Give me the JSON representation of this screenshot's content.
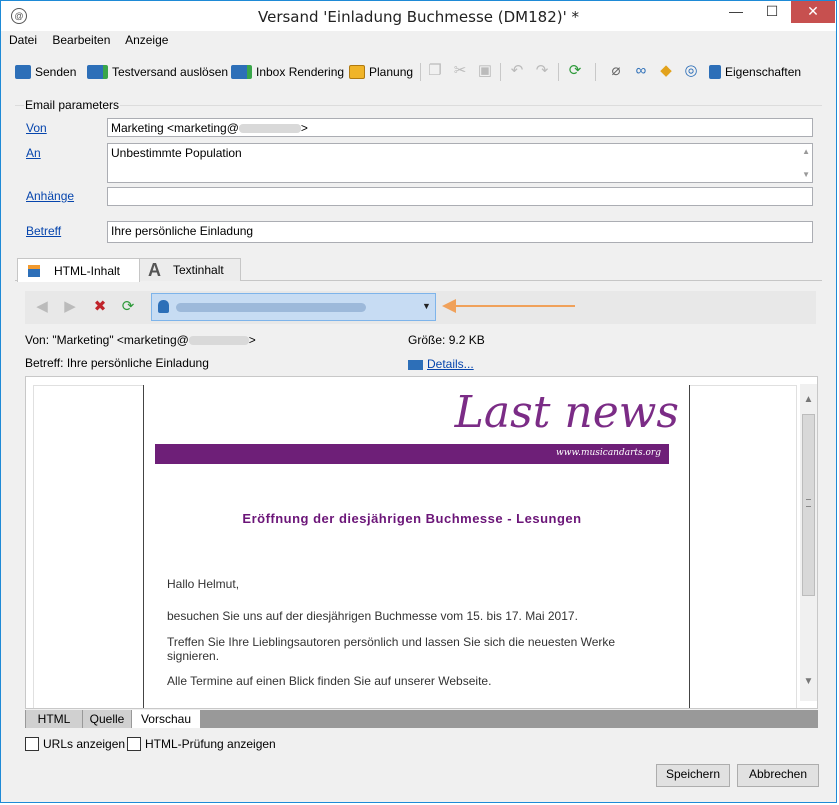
{
  "window": {
    "title": "Versand 'Einladung Buchmesse (DM182)' *",
    "app_icon": "@",
    "minimize": "—",
    "maximize": "☐",
    "close": "✕"
  },
  "menu": [
    "Datei",
    "Bearbeiten",
    "Anzeige"
  ],
  "toolbar": {
    "send": "Senden",
    "proof": "Testversand auslösen",
    "inbox": "Inbox Rendering",
    "schedule": "Planung",
    "properties": "Eigenschaften",
    "icons": [
      "copy-icon",
      "cut-icon",
      "paste-icon",
      "undo-icon",
      "redo-icon",
      "refresh-icon",
      "attachment-icon",
      "link-icon",
      "personalization-icon",
      "tracking-icon"
    ]
  },
  "params": {
    "group_label": "Email parameters",
    "from_label": "Von",
    "from_value_prefix": "Marketing <marketing@",
    "from_value_suffix": ">",
    "to_label": "An",
    "to_value": "Unbestimmte Population",
    "attach_label": "Anhänge",
    "attach_value": "",
    "subject_label": "Betreff",
    "subject_value": "Ihre persönliche Einladung"
  },
  "tabs": {
    "html": "HTML-Inhalt",
    "text": "Textinhalt",
    "text_icon": "A"
  },
  "preview": {
    "from_label": "Von:",
    "from_value_prefix": "\"Marketing\" <marketing@",
    "from_value_suffix": ">",
    "size_label": "Größe:",
    "size_value": "9.2 KB",
    "subject_label": "Betreff:",
    "subject_value": "Ihre persönliche Einladung",
    "details": "Details..."
  },
  "email": {
    "logo": "Last news",
    "url": "www.musicandarts.org",
    "heading": "Eröffnung der diesjährigen Buchmesse - Lesungen",
    "greeting": "Hallo Helmut,",
    "p1": "besuchen Sie uns auf der diesjährigen Buchmesse vom 15. bis 17. Mai 2017.",
    "p2": "Treffen Sie Ihre Lieblingsautoren persönlich und lassen Sie sich die neuesten Werke signieren.",
    "p3": "Alle Termine auf einen Blick finden Sie auf unserer Webseite."
  },
  "bottom_tabs": [
    "HTML",
    "Quelle",
    "Vorschau"
  ],
  "checkboxes": {
    "urls": "URLs anzeigen",
    "html_check": "HTML-Prüfung anzeigen"
  },
  "buttons": {
    "save": "Speichern",
    "cancel": "Abbrechen"
  },
  "colors": {
    "accent": "#6e1f78",
    "arrow": "#f0a15a",
    "link": "#0645ad"
  }
}
